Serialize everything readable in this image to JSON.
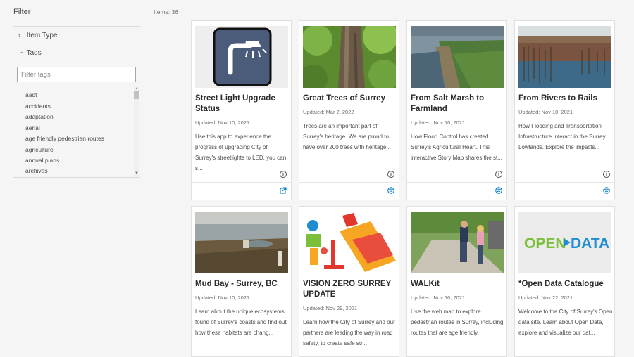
{
  "sidebar": {
    "title": "Filter",
    "item_type_label": "Item Type",
    "tags_label": "Tags",
    "filter_placeholder": "Filter tags",
    "chevron_collapsed": "›",
    "chevron_expanded": "⌄",
    "tags": [
      "aadt",
      "accidents",
      "adaptation",
      "aerial",
      "age friendly pedestrian routes",
      "agriculture",
      "annual plans",
      "archives"
    ]
  },
  "results": {
    "count_label": "Items: 36"
  },
  "cards": [
    {
      "title": "Street Light Upgrade Status",
      "updated": "Updated: Nov 10, 2021",
      "description": "Use this app to experience the progress of upgrading City of Surrey's streetlights to LED, you can s...",
      "thumb": "streetlight-icon",
      "type_icon": "external-link-icon"
    },
    {
      "title": "Great Trees of Surrey",
      "updated": "Updated: Mar 2, 2022",
      "description": "Trees are an important part of Surrey's heritage. We are proud to have over 200 trees with heritage...",
      "thumb": "tree-photo",
      "type_icon": "story-map-icon"
    },
    {
      "title": "From Salt Marsh to Farmland",
      "updated": "Updated: Nov 10, 2021",
      "description": "How Flood Control has created Surrey's Agricultural Heart. This interactive Story Map shares the st...",
      "thumb": "farmland-aerial-photo",
      "type_icon": "story-map-icon"
    },
    {
      "title": "From Rivers to Rails",
      "updated": "Updated: Nov 10, 2021",
      "description": "How Flooding and Transportation Infrastructure Interact in the Surrey Lowlands. Explore the impacts...",
      "thumb": "marsh-photo",
      "type_icon": "story-map-icon"
    },
    {
      "title": "Mud Bay - Surrey, BC",
      "updated": "Updated: Nov 10, 2021",
      "description": "Learn about the unique ecosystems found of Surrey's coasts and find out how these habitats are chang...",
      "thumb": "mud-bay-photo",
      "type_icon": "story-map-icon"
    },
    {
      "title": "VISION ZERO SURREY UPDATE",
      "updated": "Updated: Nov 29, 2021",
      "description": "Learn how the City of Surrey and our partners are leading the way in road safety, to create safe str...",
      "thumb": "vision-zero-illustration",
      "type_icon": "story-map-icon"
    },
    {
      "title": "WALKit",
      "updated": "Updated: Nov 10, 2021",
      "description": "Use the web map to explore pedestrian routes in Surrey, including routes that are age friendly.",
      "thumb": "walking-couple-photo",
      "type_icon": "web-map-icon"
    },
    {
      "title": "*Open Data Catalogue",
      "updated": "Updated: Nov 22, 2021",
      "description": "Welcome to the City of Surrey's Open data site. Learn about Open Data, explore and visualize our dat...",
      "thumb": "open-data-logo",
      "type_icon": "hub-site-icon",
      "logo_text_a": "OPEN",
      "logo_text_b": "DATA"
    }
  ],
  "colors": {
    "accent": "#0079c1",
    "streetlight_bg": "#4a5c7a",
    "open_data_green": "#7bbf3a",
    "open_data_blue": "#1f8dcf"
  }
}
